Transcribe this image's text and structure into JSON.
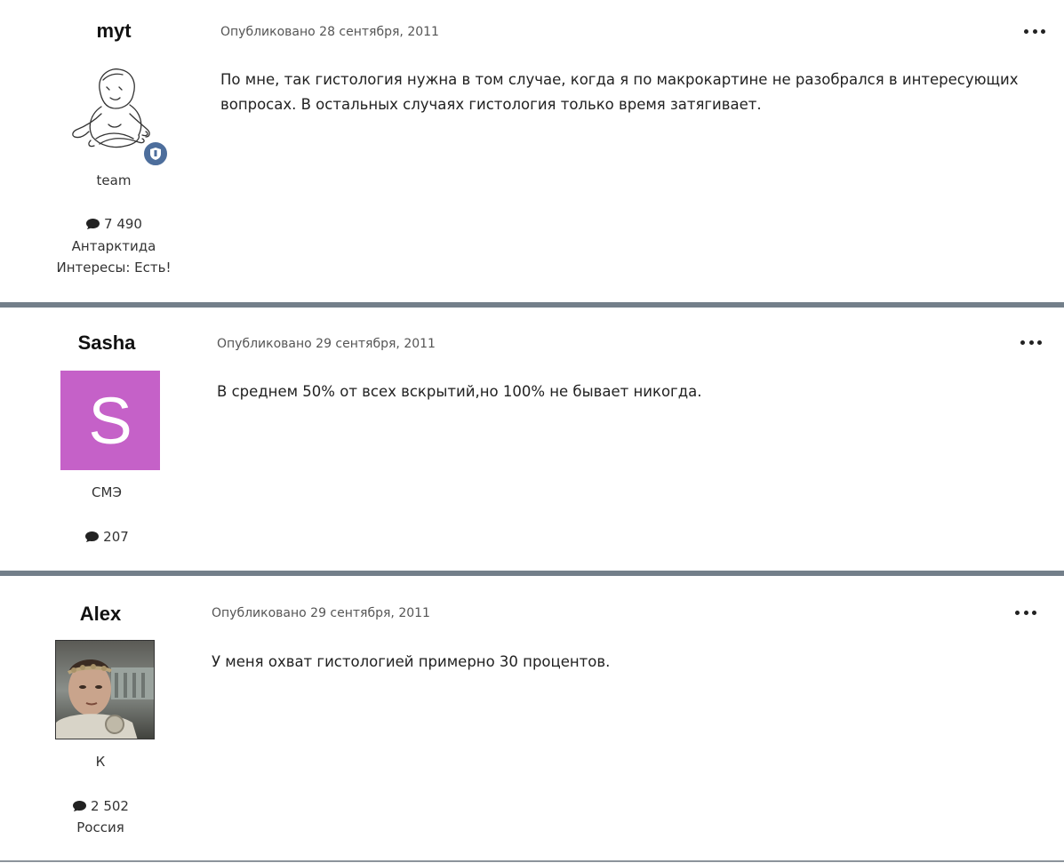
{
  "posts": [
    {
      "author": "myt",
      "group": "team",
      "posts_count": "7 490",
      "location": "Антарктида",
      "interests": "Интересы: Есть!",
      "published_label": "Опубликовано",
      "date": "28 сентября, 2011",
      "text": "По мне, так гистология нужна в том случае, когда я по макрокартине не разобрался в интересующих вопросах. В остальных случаях гистология только время затягивает.",
      "badge_icon": "shield-icon"
    },
    {
      "author": "Sasha",
      "avatar_letter": "S",
      "avatar_color": "#c561c8",
      "group": "СМЭ",
      "posts_count": "207",
      "published_label": "Опубликовано",
      "date": "29 сентября, 2011",
      "text": "В среднем 50% от всех вскрытий,но 100% не бывает никогда."
    },
    {
      "author": "Alex",
      "group": "К",
      "posts_count": "2 502",
      "location": "Россия",
      "published_label": "Опубликовано",
      "date": "29 сентября, 2011",
      "text": "У меня охват гистологией примерно 30 процентов."
    }
  ],
  "icons": {
    "comment": "comment-icon",
    "menu": "more-options-icon"
  },
  "colors": {
    "separator": "#737f8a",
    "badge": "#4d6e9c"
  }
}
